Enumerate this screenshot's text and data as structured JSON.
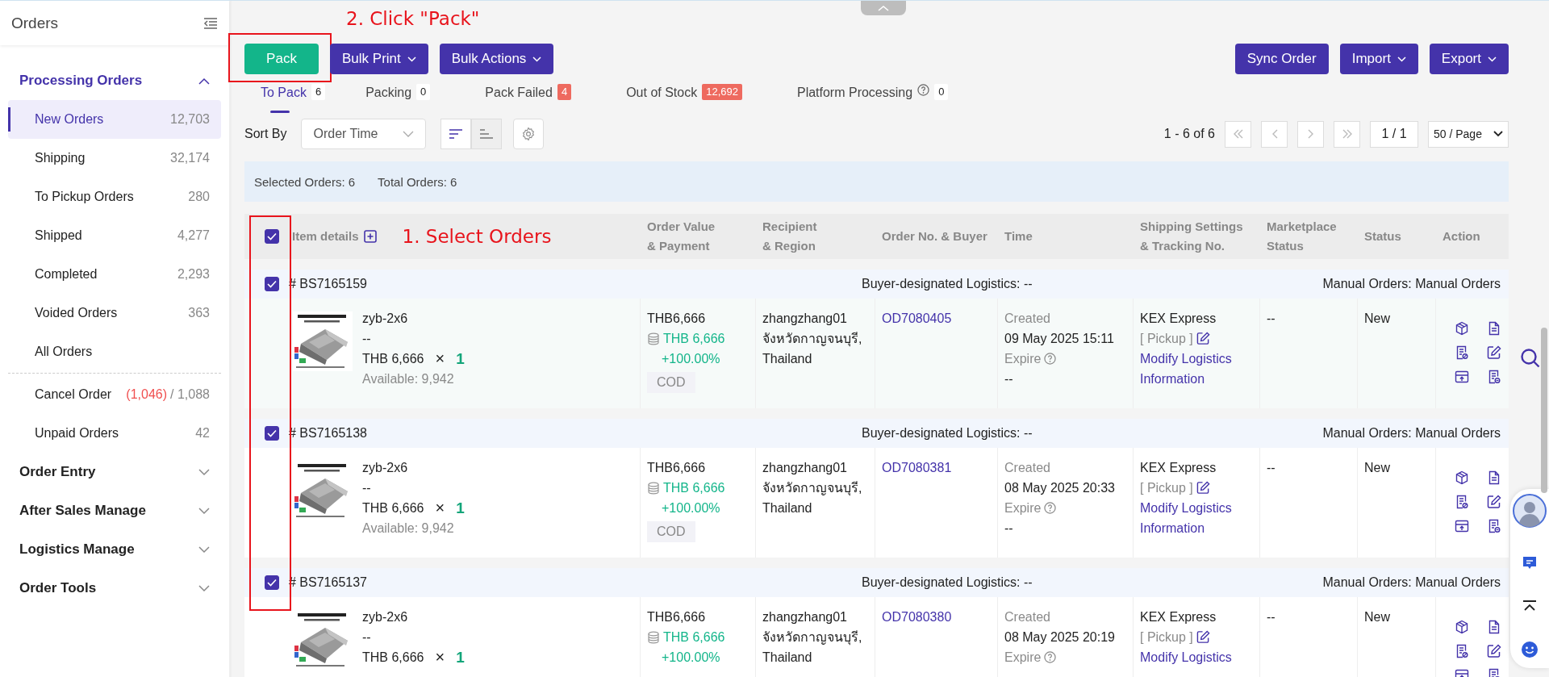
{
  "sidebar": {
    "title": "Orders",
    "groups": [
      {
        "label": "Processing Orders",
        "expanded": true,
        "items": [
          {
            "label": "New Orders",
            "count": "12,703",
            "selected": true
          },
          {
            "label": "Shipping",
            "count": "32,174",
            "selected": false
          },
          {
            "label": "To Pickup Orders",
            "count": "280",
            "selected": false
          },
          {
            "label": "Shipped",
            "count": "4,277",
            "selected": false
          },
          {
            "label": "Completed",
            "count": "2,293",
            "selected": false
          },
          {
            "label": "Voided Orders",
            "count": "363",
            "selected": false
          },
          {
            "label": "All Orders",
            "selected": false
          }
        ],
        "more_items": [
          {
            "label": "Cancel Order",
            "flagged": "(1,046)",
            "count": "/ 1,088",
            "selected": false
          },
          {
            "label": "Unpaid Orders",
            "count": "42",
            "selected": false
          }
        ]
      },
      {
        "label": "Order Entry",
        "expanded": false
      },
      {
        "label": "After Sales Manage",
        "expanded": false
      },
      {
        "label": "Logistics Manage",
        "expanded": false
      },
      {
        "label": "Order Tools",
        "expanded": false
      }
    ]
  },
  "annotations": {
    "pack_step": "2. Click \"Pack\"",
    "select_step": "1. Select Orders"
  },
  "toolbar": {
    "left": [
      {
        "label": "Pack",
        "kind": "primary"
      },
      {
        "label": "Bulk Print",
        "kind": "dropdown"
      },
      {
        "label": "Bulk Actions",
        "kind": "dropdown"
      }
    ],
    "right": [
      {
        "label": "Sync Order",
        "kind": "plain"
      },
      {
        "label": "Import",
        "kind": "dropdown"
      },
      {
        "label": "Export",
        "kind": "dropdown"
      }
    ]
  },
  "tabs": [
    {
      "label": "To Pack",
      "count": "6",
      "selected": true,
      "alert": false,
      "help": false
    },
    {
      "label": "Packing",
      "count": "0",
      "selected": false,
      "alert": false,
      "help": false
    },
    {
      "label": "Pack Failed",
      "count": "4",
      "selected": false,
      "alert": true,
      "help": false
    },
    {
      "label": "Out of Stock",
      "count": "12,692",
      "selected": false,
      "alert": true,
      "help": false
    },
    {
      "label": "Platform Processing",
      "count": "0",
      "selected": false,
      "alert": false,
      "help": true
    }
  ],
  "sort": {
    "label": "Sort By",
    "value": "Order Time",
    "descending": true
  },
  "pagination": {
    "range": "1 - 6 of 6",
    "page": "1 / 1",
    "page_size": "50 / Page"
  },
  "summary": {
    "selected": "Selected Orders: 6",
    "total": "Total Orders: 6"
  },
  "table": {
    "all_checked": true,
    "columns": [
      "Item details",
      "Order Value\n& Payment",
      "Recipient\n& Region",
      "Order No. & Buyer",
      "Time",
      "Shipping Settings\n& Tracking No.",
      "Marketplace\nStatus",
      "Status",
      "Action"
    ],
    "orders": [
      {
        "checked": true,
        "number": "# BS7165159",
        "logistics": "Buyer-designated Logistics: --",
        "source": "Manual Orders: Manual Orders",
        "item": {
          "name": "zyb-2x6",
          "variant": "--",
          "price": "THB 6,666",
          "times": "×",
          "qty": "1",
          "available": "Available: 9,942"
        },
        "value": {
          "total": "THB6,666",
          "paid": "THB 6,666",
          "percent": "+100.00%",
          "payment": "COD"
        },
        "recipient": {
          "name": "zhangzhang01",
          "region": "จังหวัดกาญจนบุรี,",
          "country": "Thailand"
        },
        "order_no": "OD7080405",
        "time": {
          "created_label": "Created",
          "created": "09 May 2025 15:11",
          "expire_label": "Expire",
          "expire": "--"
        },
        "shipping": {
          "carrier": "KEX Express",
          "pickup": "[ Pickup ]",
          "link": "Modify Logistics Information"
        },
        "marketplace": "--",
        "status": "New"
      },
      {
        "checked": true,
        "number": "# BS7165138",
        "logistics": "Buyer-designated Logistics: --",
        "source": "Manual Orders: Manual Orders",
        "item": {
          "name": "zyb-2x6",
          "variant": "--",
          "price": "THB 6,666",
          "times": "×",
          "qty": "1",
          "available": "Available: 9,942"
        },
        "value": {
          "total": "THB6,666",
          "paid": "THB 6,666",
          "percent": "+100.00%",
          "payment": "COD"
        },
        "recipient": {
          "name": "zhangzhang01",
          "region": "จังหวัดกาญจนบุรี,",
          "country": "Thailand"
        },
        "order_no": "OD7080381",
        "time": {
          "created_label": "Created",
          "created": "08 May 2025 20:33",
          "expire_label": "Expire",
          "expire": "--"
        },
        "shipping": {
          "carrier": "KEX Express",
          "pickup": "[ Pickup ]",
          "link": "Modify Logistics Information"
        },
        "marketplace": "--",
        "status": "New"
      },
      {
        "checked": true,
        "number": "# BS7165137",
        "logistics": "Buyer-designated Logistics: --",
        "source": "Manual Orders: Manual Orders",
        "item": {
          "name": "zyb-2x6",
          "variant": "--",
          "price": "THB 6,666",
          "times": "×",
          "qty": "1"
        },
        "value": {
          "total": "THB6,666",
          "paid": "THB 6,666",
          "percent": "+100.00%"
        },
        "recipient": {
          "name": "zhangzhang01",
          "region": "จังหวัดกาญจนบุรี,",
          "country": "Thailand"
        },
        "order_no": "OD7080380",
        "time": {
          "created_label": "Created",
          "created": "08 May 2025 20:19",
          "expire_label": "Expire"
        },
        "shipping": {
          "carrier": "KEX Express",
          "pickup": "[ Pickup ]",
          "link": "Modify Logistics"
        },
        "marketplace": "--",
        "status": "New"
      }
    ]
  }
}
